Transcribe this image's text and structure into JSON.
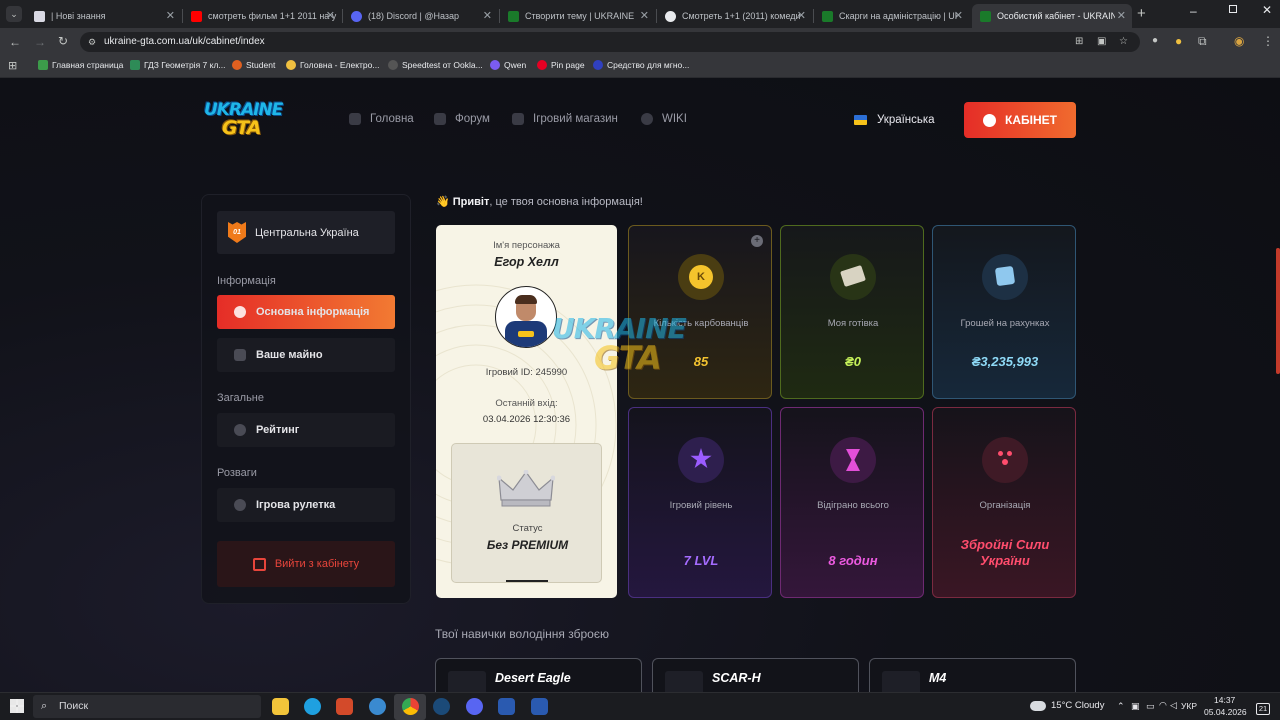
{
  "browser": {
    "tabs": [
      {
        "title": "| Нові знання",
        "color": "#d9d9e3"
      },
      {
        "title": "смотреть фильм 1+1 2011 на у",
        "color": "#ff0000"
      },
      {
        "title": "(18) Discord | @Назар",
        "color": "#5865f2"
      },
      {
        "title": "Створити тему | UKRAINE GTA",
        "color": "#1a7a2a"
      },
      {
        "title": "Смотреть 1+1 (2011) комеди",
        "color": "#e8eaed"
      },
      {
        "title": "Скарги на адміністрацію | UK",
        "color": "#1a7a2a"
      },
      {
        "title": "Особистий кабінет - UKRAINE",
        "color": "#1a7a2a"
      }
    ],
    "url": "ukraine-gta.com.ua/uk/cabinet/index",
    "bookmarks": [
      {
        "label": "Главная страница",
        "color": "#3c9b4a"
      },
      {
        "label": "ГДЗ Геометрія 7 кл...",
        "color": "#2e8b57"
      },
      {
        "label": "Student",
        "color": "#e06020"
      },
      {
        "label": "Головна - Електро...",
        "color": "#f0c040"
      },
      {
        "label": "Speedtest от Ookla...",
        "color": "#555"
      },
      {
        "label": "Qwen",
        "color": "#7b5cf0"
      },
      {
        "label": "Pin page",
        "color": "#e60023"
      },
      {
        "label": "Средство для мгно...",
        "color": "#3040c0"
      }
    ]
  },
  "site": {
    "logo_line1": "UKRAINE",
    "logo_line2": "GTA",
    "nav": [
      {
        "label": "Головна"
      },
      {
        "label": "Форум"
      },
      {
        "label": "Ігровий магазин"
      },
      {
        "label": "WIKI"
      }
    ],
    "language": "Українська",
    "cabinet_button": "КАБІНЕТ"
  },
  "sidebar": {
    "server_number": "01",
    "server_name": "Центральна Україна",
    "sections": [
      {
        "title": "Інформація",
        "items": [
          "Основна інформація",
          "Ваше майно"
        ]
      },
      {
        "title": "Загальне",
        "items": [
          "Рейтинг"
        ]
      },
      {
        "title": "Розваги",
        "items": [
          "Ігрова рулетка"
        ]
      }
    ],
    "logout": "Вийти з кабінету"
  },
  "greeting": {
    "emoji": "👋",
    "bold": "Привіт",
    "rest": ", це твоя основна інформація!"
  },
  "profile": {
    "name_label": "Ім'я персонажа",
    "name": "Егор Хелл",
    "id_label": "Ігровий ID: 245990",
    "last_login_label": "Останній вхід:",
    "last_login": "03.04.2026 12:30:36",
    "status_label": "Статус",
    "status": "Без PREMIUM"
  },
  "stats": [
    {
      "label": "Кількість карбованців",
      "value": "85",
      "icon": "coin-icon",
      "accent": "#f2c230"
    },
    {
      "label": "Моя готівка",
      "value": "₴0",
      "icon": "cash-icon",
      "accent": "#c6f25a"
    },
    {
      "label": "Грошей на рахунках",
      "value": "₴3,235,993",
      "icon": "bank-icon",
      "accent": "#7fd4f5"
    },
    {
      "label": "Ігровий рівень",
      "value": "7 LVL",
      "icon": "star-icon",
      "accent": "#9b5cff"
    },
    {
      "label": "Відіграно всього",
      "value": "8 годин",
      "icon": "hourglass-icon",
      "accent": "#e24fd8"
    },
    {
      "label": "Організація",
      "value": "Збройні Сили України",
      "icon": "organization-icon",
      "accent": "#ff4d6d"
    }
  ],
  "weapons": {
    "title": "Твої навички володіння зброєю",
    "items": [
      "Desert Eagle",
      "SCAR-H",
      "M4"
    ]
  },
  "taskbar": {
    "search": "Поиск",
    "weather": "15°C  Cloudy",
    "language": "УКР",
    "time": "14:37",
    "date": "05.04.2026",
    "notifications": "21"
  }
}
